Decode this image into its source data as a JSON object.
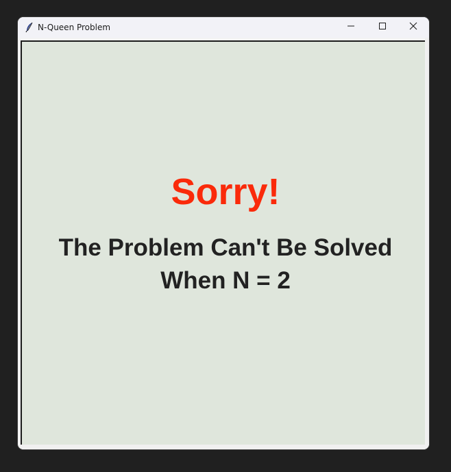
{
  "window": {
    "title": "N-Queen Problem",
    "controls": {
      "minimize": "minimize-icon",
      "maximize": "maximize-icon",
      "close": "close-icon"
    }
  },
  "content": {
    "headline": "Sorry!",
    "message_line1": "The Problem Can't Be Solved",
    "message_line2": "When N = 2"
  },
  "colors": {
    "headline": "#fa2a0a",
    "message": "#222222",
    "canvas_background": "#dfe6dc",
    "titlebar": "#f2f2f7"
  }
}
